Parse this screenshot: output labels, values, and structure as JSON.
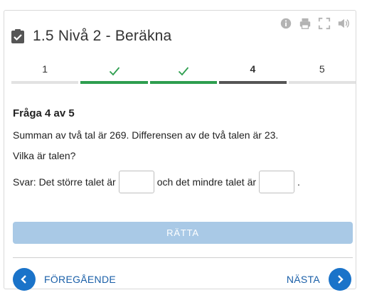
{
  "header": {
    "title": "1.5 Nivå 2 - Beräkna",
    "toolbar": [
      "info-icon",
      "print-icon",
      "fullscreen-icon",
      "speaker-icon"
    ]
  },
  "steps": [
    {
      "label": "1",
      "state": "default"
    },
    {
      "label": "",
      "state": "done"
    },
    {
      "label": "",
      "state": "done"
    },
    {
      "label": "4",
      "state": "current"
    },
    {
      "label": "5",
      "state": "default"
    }
  ],
  "question": {
    "title": "Fråga 4 av 5",
    "text": "Summan av två tal är 269. Differensen av de två talen är 23.",
    "prompt": "Vilka är talen?",
    "answer_prefix": "Svar: Det större talet är",
    "answer_middle": "och det mindre talet är",
    "answer_suffix": ".",
    "input1_value": "",
    "input2_value": ""
  },
  "buttons": {
    "check": "RÄTTA",
    "prev": "FÖREGÅENDE",
    "next": "NÄSTA"
  },
  "colors": {
    "done": "#2e9e4f",
    "current": "#555555",
    "check_button": "#a9c9e6",
    "nav_circle": "#1a73c9"
  }
}
